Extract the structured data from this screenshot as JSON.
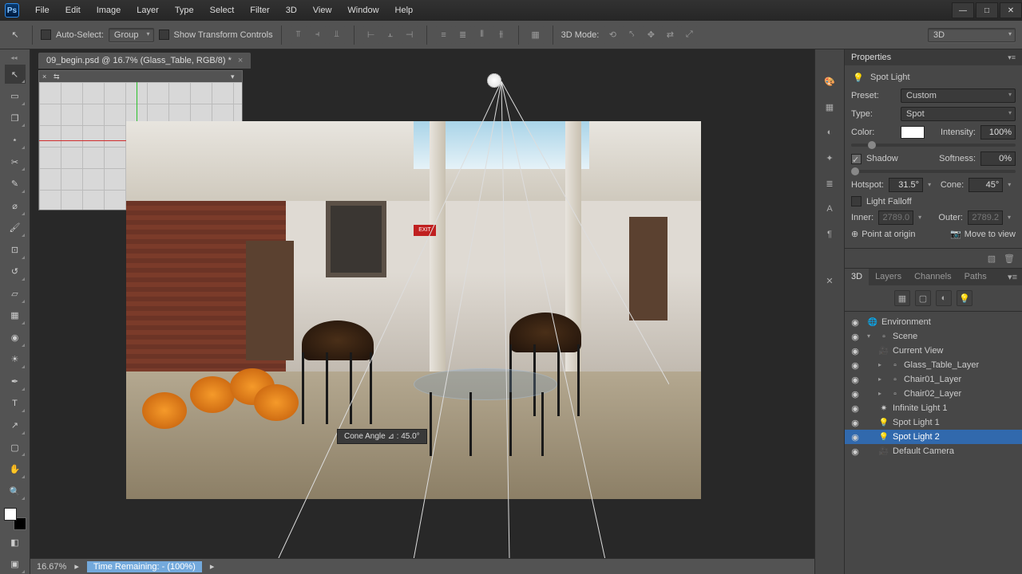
{
  "menu": [
    "File",
    "Edit",
    "Image",
    "Layer",
    "Type",
    "Select",
    "Filter",
    "3D",
    "View",
    "Window",
    "Help"
  ],
  "options": {
    "auto_select": "Auto-Select:",
    "group": "Group",
    "show_transform": "Show Transform Controls",
    "mode_label": "3D Mode:",
    "right_dd": "3D"
  },
  "doc_tab": "09_begin.psd @ 16.7% (Glass_Table, RGB/8) *",
  "tooltip": "Cone Angle ⊿ :  45.0°",
  "status": {
    "zoom": "16.67%",
    "time": "Time Remaining: - (100%)"
  },
  "properties": {
    "title": "Properties",
    "sub": "Spot Light",
    "preset_label": "Preset:",
    "preset_value": "Custom",
    "type_label": "Type:",
    "type_value": "Spot",
    "color_label": "Color:",
    "intensity_label": "Intensity:",
    "intensity_value": "100%",
    "shadow": "Shadow",
    "softness_label": "Softness:",
    "softness_value": "0%",
    "hotspot_label": "Hotspot:",
    "hotspot_value": "31.5°",
    "cone_label": "Cone:",
    "cone_value": "45°",
    "falloff": "Light Falloff",
    "inner_label": "Inner:",
    "inner_value": "2789.0",
    "outer_label": "Outer:",
    "outer_value": "2789.2",
    "point_origin": "Point at origin",
    "move_view": "Move to view"
  },
  "threeD": {
    "tabs": [
      "3D",
      "Layers",
      "Channels",
      "Paths"
    ],
    "items": [
      {
        "d": 0,
        "icon": "🌐",
        "label": "Environment"
      },
      {
        "d": 0,
        "icon": "▸",
        "label": "Scene",
        "exp": "▾"
      },
      {
        "d": 1,
        "icon": "🎥",
        "label": "Current View"
      },
      {
        "d": 1,
        "icon": "▸",
        "label": "Glass_Table_Layer"
      },
      {
        "d": 1,
        "icon": "▸",
        "label": "Chair01_Layer"
      },
      {
        "d": 1,
        "icon": "▸",
        "label": "Chair02_Layer"
      },
      {
        "d": 1,
        "icon": "✷",
        "label": "Infinite Light 1"
      },
      {
        "d": 1,
        "icon": "💡",
        "label": "Spot Light 1"
      },
      {
        "d": 1,
        "icon": "💡",
        "label": "Spot Light 2",
        "sel": true
      },
      {
        "d": 1,
        "icon": "🎥",
        "label": "Default Camera"
      }
    ]
  },
  "exit_text": "EXIT"
}
